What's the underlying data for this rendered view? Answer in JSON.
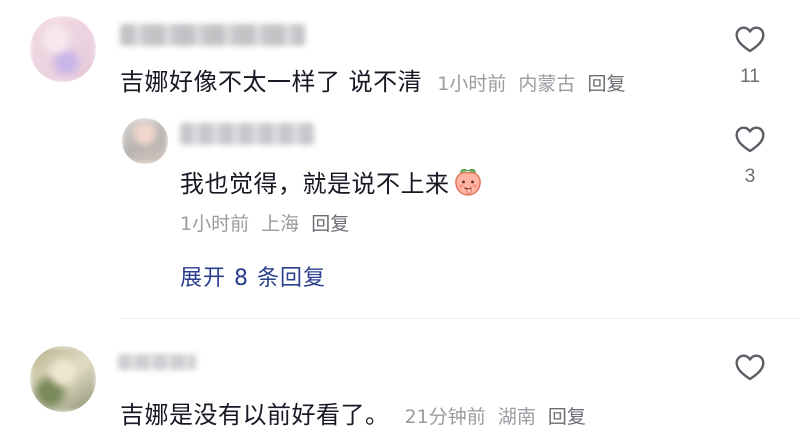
{
  "comments": [
    {
      "text": "吉娜好像不太一样了 说不清",
      "time": "1小时前",
      "location": "内蒙古",
      "reply_label": "回复",
      "likes": "11"
    },
    {
      "text": "我也觉得，就是说不上来",
      "emoji_icon": "peach-emoji-icon",
      "time": "1小时前",
      "location": "上海",
      "reply_label": "回复",
      "likes": "3",
      "expand_label": "展开 8 条回复"
    },
    {
      "text": "吉娜是没有以前好看了。",
      "time": "21分钟前",
      "location": "湖南",
      "reply_label": "回复",
      "likes": ""
    }
  ],
  "icons": {
    "like": "heart-outline-icon"
  },
  "colors": {
    "text": "#161823",
    "meta": "#9b9ca1",
    "expand": "#2a3f8f",
    "heart": "#5c5e66"
  }
}
